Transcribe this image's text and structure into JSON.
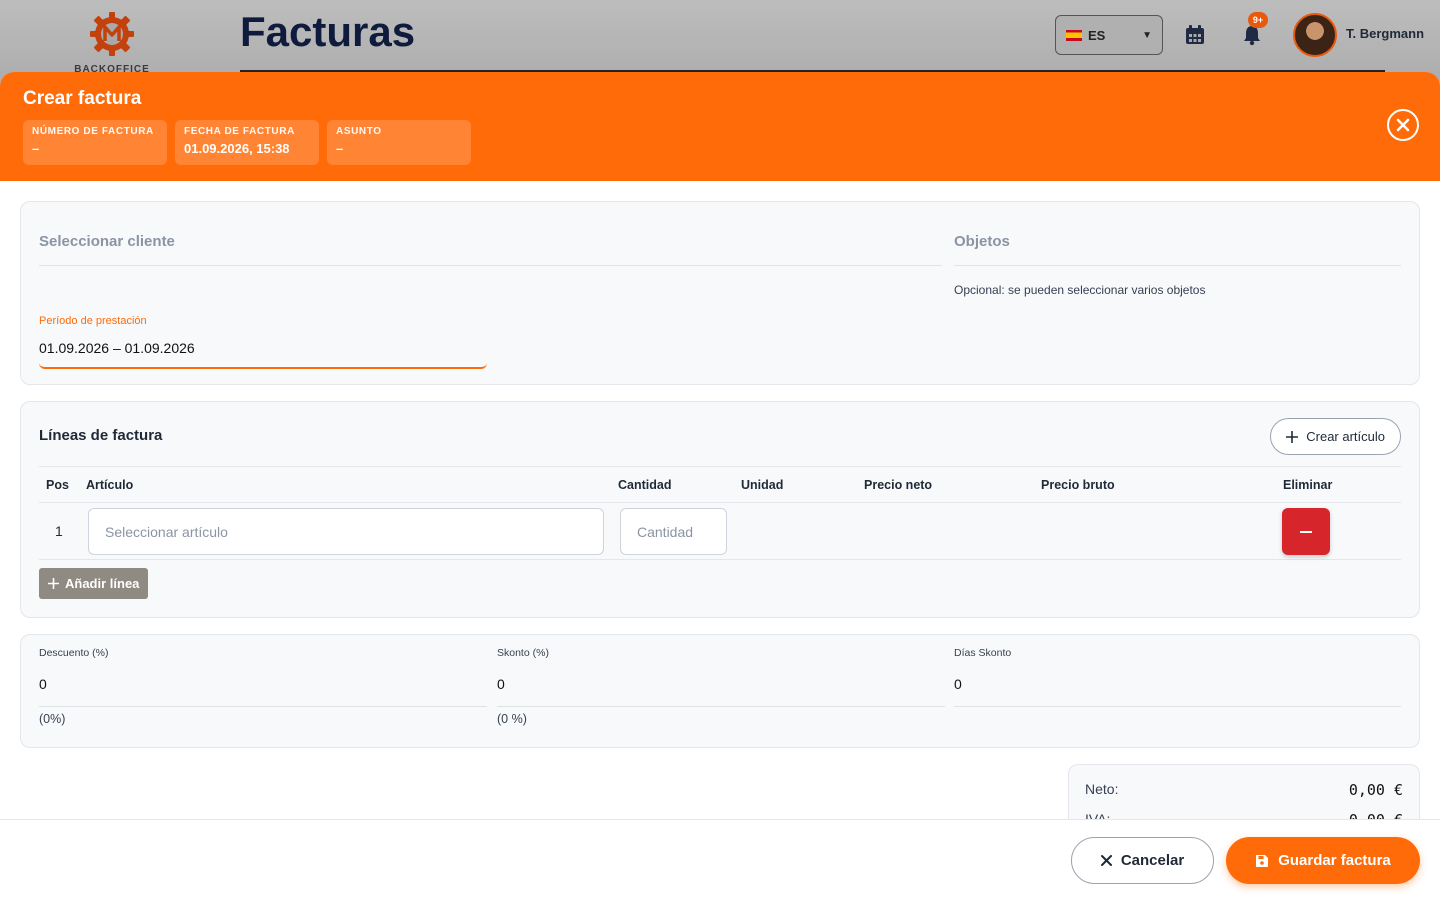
{
  "header": {
    "logo_text": "BACKOFFICE",
    "title": "Facturas",
    "language": "ES",
    "notification_count": "9+",
    "user_name": "T. Bergmann"
  },
  "modal": {
    "title": "Crear factura",
    "meta": [
      {
        "label": "Número de factura",
        "value": "–"
      },
      {
        "label": "Fecha de factura",
        "value": "01.09.2026, 15:38"
      },
      {
        "label": "Asunto",
        "value": "–"
      }
    ]
  },
  "client_section": {
    "client_placeholder": "Seleccionar cliente",
    "objects_placeholder": "Objetos",
    "objects_help": "Opcional: se pueden seleccionar varios objetos",
    "period_label": "Período de prestación",
    "period_value": "01.09.2026 – 01.09.2026"
  },
  "lines_section": {
    "title": "Líneas de factura",
    "create_article_label": "Crear artículo",
    "columns": {
      "pos": "Pos",
      "article": "Artículo",
      "quantity": "Cantidad",
      "unit": "Unidad",
      "net_price": "Precio neto",
      "gross_price": "Precio bruto",
      "delete": "Eliminar"
    },
    "rows": [
      {
        "pos": "1",
        "article_placeholder": "Seleccionar artículo",
        "quantity_placeholder": "Cantidad"
      }
    ],
    "add_line_label": "Añadir línea"
  },
  "discounts": {
    "discount_label": "Descuento (%)",
    "discount_value": "0",
    "discount_hint": "(0%)",
    "skonto_label": "Skonto (%)",
    "skonto_value": "0",
    "skonto_hint": "(0 %)",
    "skonto_days_label": "Días Skonto",
    "skonto_days_value": "0"
  },
  "totals": {
    "net_label": "Neto:",
    "net_value": "0,00 €",
    "vat_label": "IVA:",
    "vat_value": "0,00 €"
  },
  "footer": {
    "cancel_label": "Cancelar",
    "save_label": "Guardar factura"
  },
  "colors": {
    "accent": "#ff6b08",
    "danger": "#d7262b"
  }
}
